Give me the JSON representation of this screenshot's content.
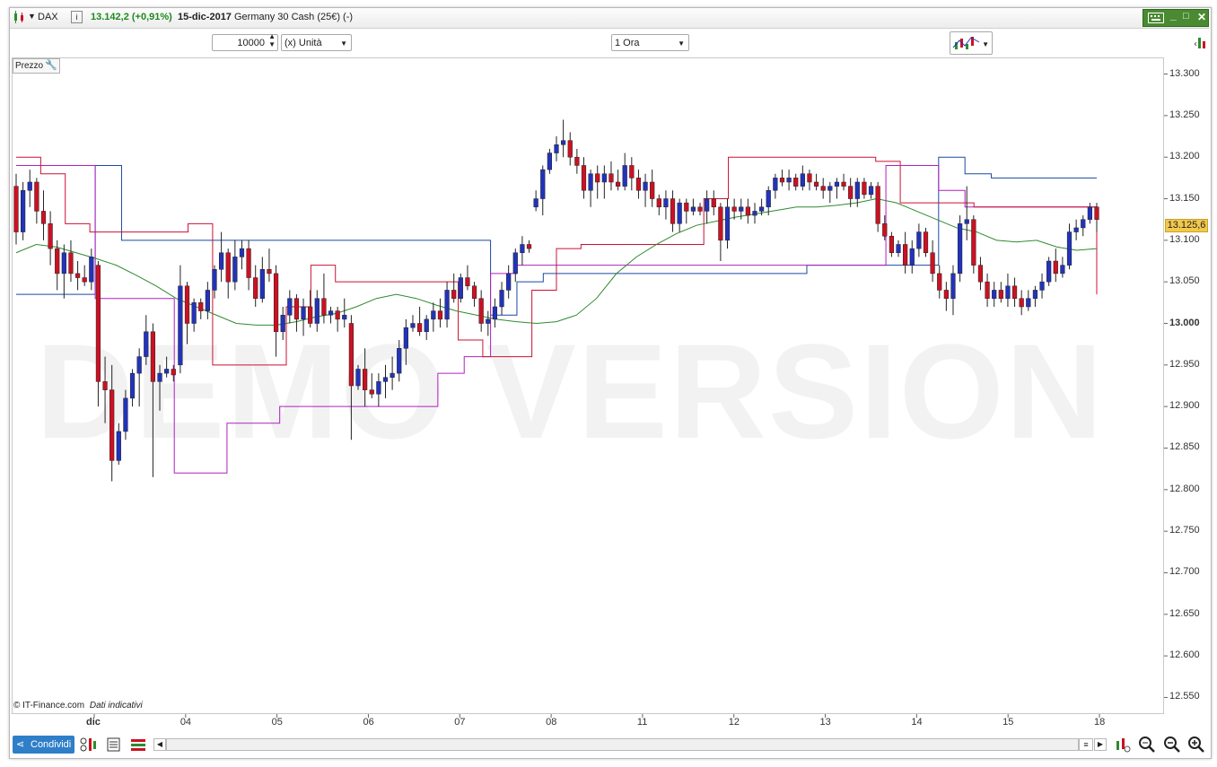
{
  "header": {
    "symbol": "DAX",
    "quote": "13.142,2 (+0,91%)",
    "date": "15-dic-2017",
    "instrument": "Germany 30 Cash (25€) (-)"
  },
  "toolbar": {
    "quantity": "10000",
    "unit": "(x) Unità",
    "timeframe": "1 Ora"
  },
  "panel": {
    "price_label": "Prezzo",
    "watermark": "DEMO VERSION",
    "source": "© IT-Finance.com",
    "source_note": "Dati indicativi",
    "share_label": "Condividi",
    "last_price": "13.125,6"
  },
  "colors": {
    "up_candle": "#2233bb",
    "down_candle": "#cc1122",
    "ma_line": "#2f8a2f",
    "resist_red": "#cc1133",
    "channel_purple": "#b020c0",
    "channel_blue": "#1a4aa0",
    "accent_green": "#4a8a32"
  },
  "chart_data": {
    "type": "candlestick",
    "title": "",
    "y_ticks": [
      "13.300",
      "13.250",
      "13.200",
      "13.150",
      "13.100",
      "13.050",
      "13.000",
      "12.950",
      "12.900",
      "12.850",
      "12.800",
      "12.750",
      "12.700",
      "12.650",
      "12.600",
      "12.550"
    ],
    "ylim": [
      12530,
      13320
    ],
    "x_ticks": [
      "dic",
      "04",
      "05",
      "06",
      "07",
      "08",
      "11",
      "12",
      "13",
      "14",
      "15",
      "18"
    ],
    "candles": [
      [
        13165,
        13180,
        13095,
        13110
      ],
      [
        13110,
        13170,
        13100,
        13160
      ],
      [
        13160,
        13185,
        13140,
        13170
      ],
      [
        13170,
        13175,
        13120,
        13135
      ],
      [
        13135,
        13160,
        13100,
        13120
      ],
      [
        13120,
        13135,
        13070,
        13090
      ],
      [
        13090,
        13100,
        13040,
        13060
      ],
      [
        13060,
        13095,
        13030,
        13085
      ],
      [
        13085,
        13100,
        13050,
        13060
      ],
      [
        13060,
        13075,
        13040,
        13055
      ],
      [
        13055,
        13070,
        13045,
        13050
      ],
      [
        13050,
        13090,
        13040,
        13080
      ],
      [
        13070,
        13075,
        12900,
        12930
      ],
      [
        12930,
        12960,
        12880,
        12920
      ],
      [
        12920,
        12950,
        12810,
        12835
      ],
      [
        12835,
        12880,
        12830,
        12870
      ],
      [
        12870,
        12920,
        12860,
        12910
      ],
      [
        12910,
        12945,
        12900,
        12940
      ],
      [
        12940,
        12970,
        12900,
        12960
      ],
      [
        12960,
        13010,
        12950,
        12990
      ],
      [
        12990,
        13000,
        12815,
        12930
      ],
      [
        12930,
        12950,
        12895,
        12940
      ],
      [
        12940,
        12960,
        12935,
        12945
      ],
      [
        12945,
        12950,
        12930,
        12938
      ],
      [
        12950,
        13070,
        12940,
        13045
      ],
      [
        13045,
        13050,
        12975,
        13000
      ],
      [
        13000,
        13030,
        12990,
        13025
      ],
      [
        13025,
        13030,
        13005,
        13015
      ],
      [
        13015,
        13050,
        13005,
        13040
      ],
      [
        13040,
        13070,
        13030,
        13065
      ],
      [
        13065,
        13110,
        13050,
        13085
      ],
      [
        13085,
        13090,
        13030,
        13050
      ],
      [
        13050,
        13100,
        13040,
        13080
      ],
      [
        13080,
        13100,
        13065,
        13090
      ],
      [
        13090,
        13100,
        13040,
        13055
      ],
      [
        13055,
        13070,
        13020,
        13030
      ],
      [
        13030,
        13080,
        13025,
        13065
      ],
      [
        13065,
        13090,
        13050,
        13060
      ],
      [
        13060,
        13070,
        12960,
        12990
      ],
      [
        12990,
        13020,
        12980,
        13010
      ],
      [
        13010,
        13040,
        13000,
        13030
      ],
      [
        13030,
        13035,
        12990,
        13005
      ],
      [
        13005,
        13030,
        12985,
        13020
      ],
      [
        13020,
        13040,
        12995,
        13000
      ],
      [
        13000,
        13040,
        12990,
        13030
      ],
      [
        13030,
        13060,
        13000,
        13010
      ],
      [
        13010,
        13020,
        13000,
        13015
      ],
      [
        13015,
        13020,
        12990,
        13005
      ],
      [
        13005,
        13030,
        12995,
        13010
      ],
      [
        13000,
        13010,
        12860,
        12925
      ],
      [
        12925,
        12950,
        12920,
        12945
      ],
      [
        12945,
        12970,
        12900,
        12920
      ],
      [
        12920,
        12940,
        12910,
        12915
      ],
      [
        12915,
        12940,
        12900,
        12930
      ],
      [
        12930,
        12950,
        12910,
        12935
      ],
      [
        12935,
        12960,
        12920,
        12940
      ],
      [
        12940,
        12980,
        12930,
        12970
      ],
      [
        12970,
        13005,
        12950,
        12995
      ],
      [
        12995,
        13010,
        12990,
        13000
      ],
      [
        13000,
        13020,
        12985,
        12990
      ],
      [
        12990,
        13010,
        12980,
        13005
      ],
      [
        13005,
        13025,
        12990,
        13015
      ],
      [
        13015,
        13030,
        12995,
        13005
      ],
      [
        13005,
        13050,
        12995,
        13040
      ],
      [
        13040,
        13060,
        13025,
        13030
      ],
      [
        13030,
        13060,
        13025,
        13055
      ],
      [
        13055,
        13070,
        13040,
        13045
      ],
      [
        13045,
        13050,
        13020,
        13030
      ],
      [
        13030,
        13040,
        12990,
        13000
      ],
      [
        13000,
        13015,
        12985,
        13005
      ],
      [
        13005,
        13030,
        12995,
        13020
      ],
      [
        13020,
        13050,
        13010,
        13040
      ],
      [
        13040,
        13070,
        13030,
        13060
      ],
      [
        13060,
        13090,
        13050,
        13085
      ],
      [
        13085,
        13105,
        13070,
        13095
      ],
      [
        13095,
        13100,
        13085,
        13090
      ],
      [
        13140,
        13160,
        13135,
        13150
      ],
      [
        13150,
        13190,
        13130,
        13185
      ],
      [
        13185,
        13210,
        13180,
        13205
      ],
      [
        13205,
        13225,
        13195,
        13215
      ],
      [
        13215,
        13245,
        13200,
        13220
      ],
      [
        13220,
        13230,
        13190,
        13200
      ],
      [
        13200,
        13210,
        13180,
        13190
      ],
      [
        13190,
        13200,
        13150,
        13160
      ],
      [
        13160,
        13185,
        13140,
        13180
      ],
      [
        13180,
        13190,
        13150,
        13170
      ],
      [
        13170,
        13190,
        13150,
        13180
      ],
      [
        13180,
        13195,
        13160,
        13170
      ],
      [
        13170,
        13185,
        13160,
        13165
      ],
      [
        13165,
        13205,
        13160,
        13190
      ],
      [
        13190,
        13200,
        13160,
        13175
      ],
      [
        13175,
        13185,
        13150,
        13160
      ],
      [
        13160,
        13180,
        13140,
        13170
      ],
      [
        13170,
        13185,
        13140,
        13150
      ],
      [
        13150,
        13155,
        13130,
        13140
      ],
      [
        13140,
        13160,
        13125,
        13150
      ],
      [
        13150,
        13160,
        13110,
        13120
      ],
      [
        13120,
        13150,
        13110,
        13145
      ],
      [
        13145,
        13150,
        13120,
        13135
      ],
      [
        13135,
        13150,
        13130,
        13140
      ],
      [
        13140,
        13145,
        13130,
        13135
      ],
      [
        13135,
        13160,
        13120,
        13150
      ],
      [
        13150,
        13160,
        13130,
        13140
      ],
      [
        13140,
        13145,
        13075,
        13100
      ],
      [
        13100,
        13150,
        13090,
        13140
      ],
      [
        13140,
        13150,
        13125,
        13135
      ],
      [
        13135,
        13150,
        13125,
        13140
      ],
      [
        13140,
        13150,
        13120,
        13130
      ],
      [
        13130,
        13145,
        13120,
        13135
      ],
      [
        13135,
        13150,
        13130,
        13140
      ],
      [
        13140,
        13165,
        13130,
        13160
      ],
      [
        13160,
        13180,
        13150,
        13175
      ],
      [
        13175,
        13185,
        13165,
        13170
      ],
      [
        13170,
        13185,
        13160,
        13175
      ],
      [
        13175,
        13180,
        13160,
        13165
      ],
      [
        13165,
        13190,
        13160,
        13180
      ],
      [
        13180,
        13185,
        13160,
        13170
      ],
      [
        13170,
        13180,
        13160,
        13165
      ],
      [
        13165,
        13175,
        13150,
        13160
      ],
      [
        13160,
        13170,
        13145,
        13165
      ],
      [
        13165,
        13175,
        13150,
        13170
      ],
      [
        13170,
        13180,
        13160,
        13165
      ],
      [
        13165,
        13175,
        13140,
        13150
      ],
      [
        13150,
        13175,
        13140,
        13170
      ],
      [
        13170,
        13175,
        13150,
        13155
      ],
      [
        13155,
        13170,
        13150,
        13165
      ],
      [
        13165,
        13170,
        13110,
        13120
      ],
      [
        13120,
        13130,
        13100,
        13105
      ],
      [
        13105,
        13110,
        13080,
        13085
      ],
      [
        13085,
        13100,
        13080,
        13095
      ],
      [
        13095,
        13110,
        13060,
        13070
      ],
      [
        13070,
        13100,
        13060,
        13090
      ],
      [
        13090,
        13120,
        13080,
        13110
      ],
      [
        13110,
        13115,
        13080,
        13085
      ],
      [
        13085,
        13100,
        13050,
        13060
      ],
      [
        13060,
        13070,
        13030,
        13040
      ],
      [
        13040,
        13050,
        13015,
        13030
      ],
      [
        13030,
        13070,
        13010,
        13060
      ],
      [
        13060,
        13130,
        13050,
        13120
      ],
      [
        13120,
        13165,
        13100,
        13125
      ],
      [
        13125,
        13130,
        13060,
        13070
      ],
      [
        13070,
        13080,
        13040,
        13050
      ],
      [
        13050,
        13060,
        13020,
        13030
      ],
      [
        13030,
        13050,
        13020,
        13040
      ],
      [
        13040,
        13050,
        13025,
        13030
      ],
      [
        13030,
        13060,
        13020,
        13045
      ],
      [
        13045,
        13055,
        13020,
        13030
      ],
      [
        13030,
        13040,
        13010,
        13020
      ],
      [
        13020,
        13040,
        13015,
        13030
      ],
      [
        13030,
        13045,
        13020,
        13040
      ],
      [
        13040,
        13060,
        13030,
        13050
      ],
      [
        13050,
        13080,
        13045,
        13075
      ],
      [
        13075,
        13090,
        13050,
        13060
      ],
      [
        13060,
        13080,
        13055,
        13070
      ],
      [
        13070,
        13120,
        13065,
        13110
      ],
      [
        13110,
        13125,
        13100,
        13115
      ],
      [
        13115,
        13130,
        13105,
        13125
      ],
      [
        13125,
        13145,
        13120,
        13140
      ],
      [
        13140,
        13145,
        13110,
        13125
      ]
    ],
    "moving_average": [
      13085,
      13095,
      13092,
      13085,
      13078,
      13070,
      13058,
      13045,
      13030,
      13020,
      13010,
      13000,
      12998,
      12998,
      13002,
      13008,
      13012,
      13020,
      13030,
      13035,
      13030,
      13022,
      13015,
      13010,
      13005,
      13002,
      13000,
      13002,
      13010,
      13030,
      13060,
      13080,
      13095,
      13108,
      13118,
      13123,
      13128,
      13132,
      13136,
      13140,
      13140,
      13142,
      13145,
      13150,
      13145,
      13135,
      13125,
      13115,
      13110,
      13100,
      13098,
      13100,
      13092,
      13088,
      13090
    ],
    "resistance_red": [
      13200,
      13180,
      13120,
      13110,
      13110,
      13110,
      13110,
      13120,
      12950,
      12950,
      12950,
      13020,
      13070,
      13050,
      13050,
      13050,
      13050,
      13050,
      12980,
      12960,
      12960,
      13040,
      13090,
      13095,
      13095,
      13095,
      13095,
      13095,
      13150,
      13200,
      13200,
      13200,
      13200,
      13200,
      13200,
      13195,
      13145,
      13145,
      13145,
      13140,
      13140,
      13140,
      13140,
      13140,
      13035
    ],
    "channel_purple": [
      13190,
      13190,
      13190,
      13030,
      13030,
      13030,
      12820,
      12820,
      12880,
      12880,
      12900,
      12900,
      12900,
      12900,
      12900,
      12900,
      12940,
      12960,
      13060,
      13070,
      13070,
      13070,
      13070,
      13070,
      13070,
      13070,
      13070,
      13070,
      13070,
      13070,
      13070,
      13070,
      13070,
      13190,
      13190,
      13160,
      13140,
      13140,
      13140,
      13140,
      13140,
      13140
    ],
    "channel_blue": [
      13035,
      13035,
      13035,
      13190,
      13100,
      13100,
      13100,
      13100,
      13100,
      13100,
      13100,
      13100,
      13100,
      13100,
      13100,
      13100,
      13100,
      13100,
      13010,
      13050,
      13060,
      13060,
      13060,
      13060,
      13060,
      13060,
      13060,
      13060,
      13060,
      13060,
      13070,
      13070,
      13070,
      13070,
      13070,
      13200,
      13180,
      13175,
      13175,
      13175,
      13175,
      13175
    ]
  }
}
